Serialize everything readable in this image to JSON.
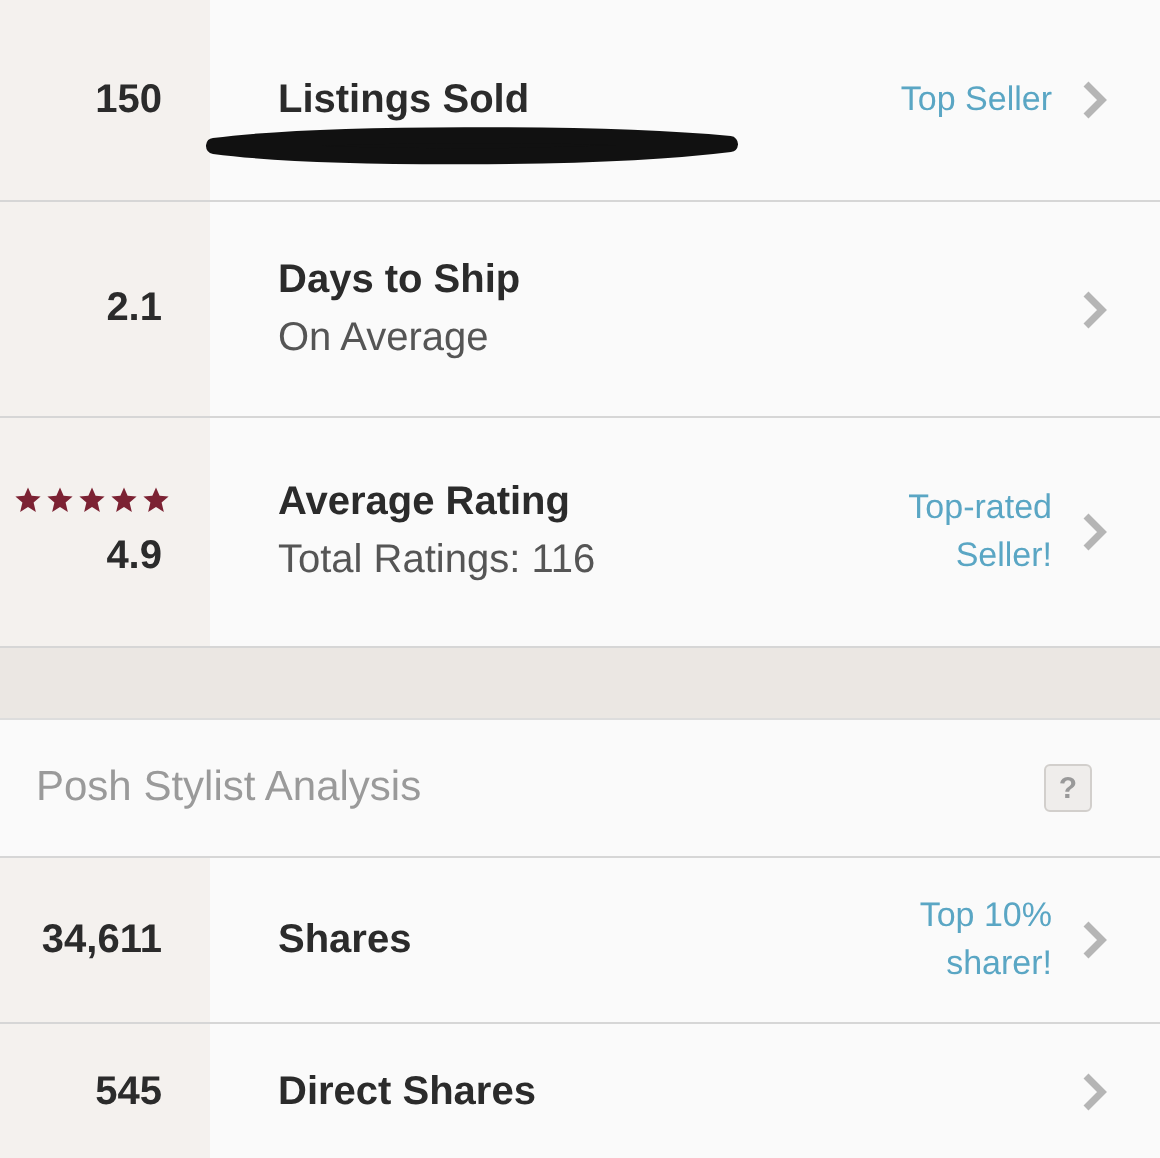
{
  "stats": [
    {
      "value": "150",
      "title": "Listings Sold",
      "badge": "Top Seller",
      "redacted": true
    },
    {
      "value": "2.1",
      "title": "Days to Ship",
      "subtitle": "On Average"
    },
    {
      "value": "4.9",
      "stars": 5,
      "title": "Average Rating",
      "subtitle": "Total Ratings: 116",
      "badge": "Top-rated Seller!"
    }
  ],
  "stylist": {
    "heading": "Posh Stylist Analysis",
    "help": "?",
    "rows": [
      {
        "value": "34,611",
        "title": "Shares",
        "badge": "Top 10% sharer!"
      },
      {
        "value": "545",
        "title": "Direct Shares"
      }
    ]
  }
}
